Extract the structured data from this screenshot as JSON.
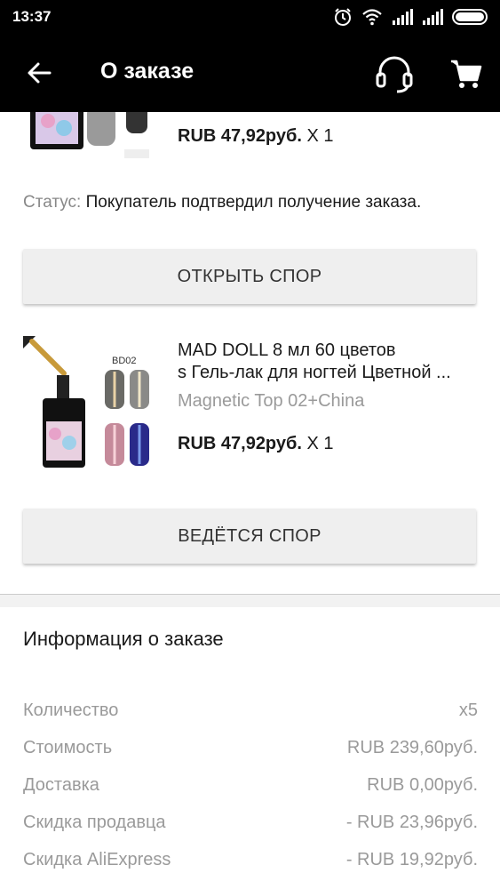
{
  "status_bar": {
    "time": "13:37"
  },
  "appbar": {
    "title": "О заказе",
    "icons": [
      "back-arrow-icon",
      "headset-icon",
      "cart-icon"
    ]
  },
  "order_items": [
    {
      "price": "RUB 47,92руб.",
      "qty": "X 1",
      "status_label": "Статус:",
      "status_text": "Покупатель подтвердил получение заказа.",
      "button": "ОТКРЫТЬ СПОР"
    },
    {
      "title_line1": "MAD DOLL 8 мл 60 цветов",
      "title_line2": "s Гель-лак для ногтей Цветной ...",
      "variant": "Magnetic Top 02+China",
      "image_label": "BD02",
      "price": "RUB 47,92руб.",
      "qty": "X 1",
      "button": "ВЕДЁТСЯ СПОР"
    }
  ],
  "order_info": {
    "title": "Информация о заказе",
    "rows": [
      {
        "label": "Количество",
        "value": "x5"
      },
      {
        "label": "Стоимость",
        "value": "RUB 239,60руб."
      },
      {
        "label": "Доставка",
        "value": "RUB 0,00руб."
      },
      {
        "label": "Скидка продавца",
        "value": "- RUB 23,96руб."
      },
      {
        "label": "Скидка AliExpress",
        "value": "- RUB 19,92руб."
      }
    ]
  },
  "colors": {
    "bar": "#000000",
    "button_bg": "#efefef",
    "muted_text": "#9a9a9a"
  }
}
